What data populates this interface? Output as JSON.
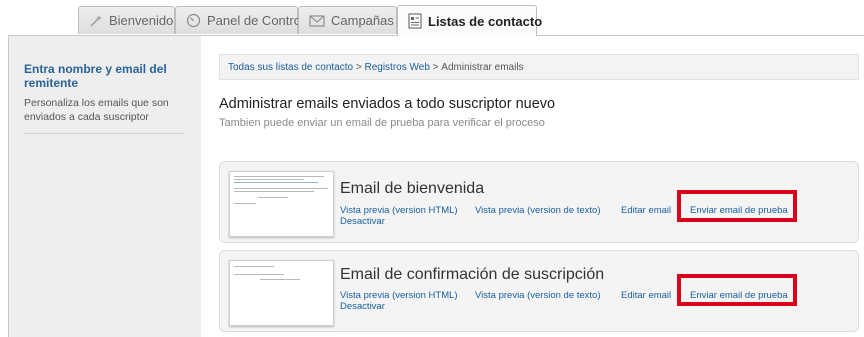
{
  "tabs": [
    {
      "label": "Bienvenido",
      "icon": "magic-wand-icon"
    },
    {
      "label": "Panel de Control",
      "icon": "gauge-icon"
    },
    {
      "label": "Campañas",
      "icon": "envelope-icon"
    },
    {
      "label": "Listas de contacto",
      "icon": "contact-list-icon",
      "active": true
    }
  ],
  "sidebar": {
    "title": "Entra nombre y email del remitente",
    "description": "Personaliza los emails que son enviados a cada suscriptor"
  },
  "breadcrumb": {
    "lists": "Todas sus listas de contacto",
    "sep1": " > ",
    "list": "Registros Web",
    "sep2": " > ",
    "current": "Administrar emails"
  },
  "main": {
    "title": "Administrar emails enviados a todo suscriptor nuevo",
    "subtitle": "Tambien puede enviar un email de prueba para verificar el proceso"
  },
  "emails": [
    {
      "title": "Email de bienvenida",
      "preview_html": "Vista previa (version HTML)",
      "preview_text": "Vista previa (version de texto)",
      "edit": "Editar email",
      "test": "Enviar email de prueba",
      "deactivate": "Desactivar"
    },
    {
      "title": "Email de confirmación de suscripción",
      "preview_html": "Vista previa (version HTML)",
      "preview_text": "Vista previa (version de texto)",
      "edit": "Editar email",
      "test": "Enviar email de prueba",
      "deactivate": "Desactivar"
    }
  ],
  "colors": {
    "link": "#1a5fa0",
    "highlight": "#d8001c",
    "sidebar_title": "#2a6496"
  }
}
